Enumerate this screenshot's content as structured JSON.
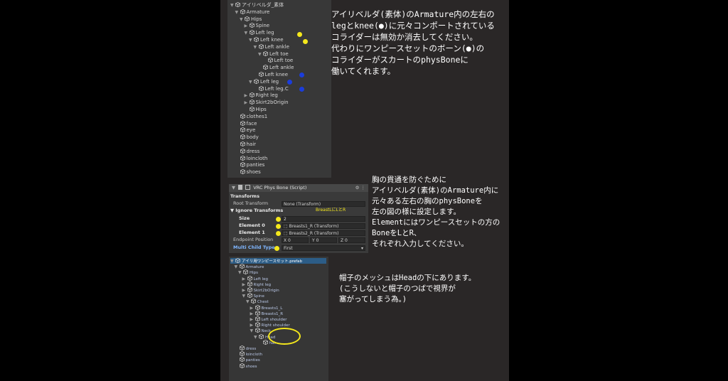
{
  "hierarchy1": {
    "rows": [
      {
        "label": "アイリベルダ_素体",
        "indent": 0,
        "tri": "▼"
      },
      {
        "label": "Armature",
        "indent": 1,
        "tri": "▼"
      },
      {
        "label": "Hips",
        "indent": 2,
        "tri": "▼"
      },
      {
        "label": "Spine",
        "indent": 3,
        "tri": "▶"
      },
      {
        "label": "Left leg",
        "indent": 3,
        "tri": "▼"
      },
      {
        "label": "Left knee",
        "indent": 4,
        "tri": "▼"
      },
      {
        "label": "Left ankle",
        "indent": 5,
        "tri": "▼"
      },
      {
        "label": "Left toe",
        "indent": 6,
        "tri": "▼"
      },
      {
        "label": "Left toe",
        "indent": 7,
        "tri": ""
      },
      {
        "label": "Left ankle",
        "indent": 6,
        "tri": ""
      },
      {
        "label": "Left knee",
        "indent": 5,
        "tri": ""
      },
      {
        "label": "Left leg",
        "indent": 4,
        "tri": "▼"
      },
      {
        "label": "Left leg.C",
        "indent": 5,
        "tri": ""
      },
      {
        "label": "Right leg",
        "indent": 3,
        "tri": "▶"
      },
      {
        "label": "Skirt2bOrigin",
        "indent": 3,
        "tri": "▶"
      },
      {
        "label": "Hips",
        "indent": 3,
        "tri": ""
      },
      {
        "label": "clothes1",
        "indent": 1,
        "tri": ""
      },
      {
        "label": "face",
        "indent": 1,
        "tri": ""
      },
      {
        "label": "eye",
        "indent": 1,
        "tri": ""
      },
      {
        "label": "body",
        "indent": 1,
        "tri": ""
      },
      {
        "label": "hair",
        "indent": 1,
        "tri": ""
      },
      {
        "label": "dress",
        "indent": 1,
        "tri": ""
      },
      {
        "label": "loincloth",
        "indent": 1,
        "tri": ""
      },
      {
        "label": "panties",
        "indent": 1,
        "tri": ""
      },
      {
        "label": "shoes",
        "indent": 1,
        "tri": ""
      }
    ]
  },
  "note1": "アイリベルダ(素体)のArmature内の左右の\nlegとknee(●)に元々コンポートされている\nコライダーは無効か消去してください。\n代わりにワンピースセットのボーン(●)の\nコライダーがスカートのphysBoneに\n働いてくれます。",
  "inspector": {
    "title": "VRC Phys Bone (Script)",
    "section": "Transforms",
    "root_transform_label": "Root Transform",
    "root_transform_value": "None (Transform)",
    "ignore_label": "Ignore Transforms",
    "annotation": "BreastLにLとR",
    "size_label": "Size",
    "size_value": "2",
    "element0_label": "Element 0",
    "element0_value": "Breasts1_R (Transform)",
    "element1_label": "Element 1",
    "element1_value": "Breasts2_R (Transform)",
    "endpoint_label": "Endpoint Position",
    "endpoint_x": "X 0",
    "endpoint_y": "Y 0",
    "endpoint_z": "Z 0",
    "multi_child_label": "Multi Child Type",
    "multi_child_value": "First"
  },
  "note2": "胸の貫通を防ぐために\nアイリベルダ(素体)のArmature内に\n元々ある左右の胸のphysBoneを\n左の図の様に設定します。\nElementにはワンピースセットの方の\nBoneをLとR、\nそれぞれ入力してください。",
  "hierarchy2": {
    "rows": [
      {
        "label": "アイリ用ワンピースセット.prefab",
        "indent": 0,
        "tri": "▼"
      },
      {
        "label": "Armature",
        "indent": 1,
        "tri": "▼"
      },
      {
        "label": "Hips",
        "indent": 2,
        "tri": "▼"
      },
      {
        "label": "Left leg",
        "indent": 3,
        "tri": "▶"
      },
      {
        "label": "Right leg",
        "indent": 3,
        "tri": "▶"
      },
      {
        "label": "Skirt2bOrigin",
        "indent": 3,
        "tri": "▶"
      },
      {
        "label": "Spine",
        "indent": 3,
        "tri": "▼"
      },
      {
        "label": "Chest",
        "indent": 4,
        "tri": "▼"
      },
      {
        "label": "Breasts1_L",
        "indent": 5,
        "tri": "▶"
      },
      {
        "label": "Breasts1_R",
        "indent": 5,
        "tri": "▶"
      },
      {
        "label": "Left shoulder",
        "indent": 5,
        "tri": "▶"
      },
      {
        "label": "Right shoulder",
        "indent": 5,
        "tri": "▶"
      },
      {
        "label": "Neck",
        "indent": 5,
        "tri": "▼"
      },
      {
        "label": "Head",
        "indent": 6,
        "tri": "▼"
      },
      {
        "label": "hat",
        "indent": 7,
        "tri": ""
      },
      {
        "label": "dress",
        "indent": 1,
        "tri": ""
      },
      {
        "label": "loincloth",
        "indent": 1,
        "tri": ""
      },
      {
        "label": "panties",
        "indent": 1,
        "tri": ""
      },
      {
        "label": "shoes",
        "indent": 1,
        "tri": ""
      }
    ]
  },
  "note3": "帽子のメッシュはHeadの下にあります。\n(こうしないと帽子のつばで視界が\n塞がってしまう為。)",
  "colors": {
    "yellow": "#f5e81c",
    "blue": "#1b3ddb"
  }
}
